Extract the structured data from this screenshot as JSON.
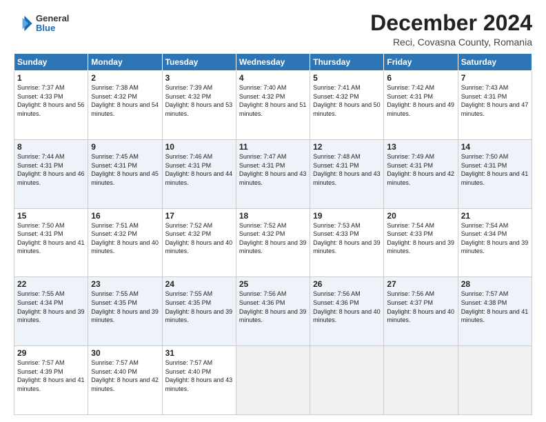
{
  "logo": {
    "general": "General",
    "blue": "Blue"
  },
  "title": "December 2024",
  "subtitle": "Reci, Covasna County, Romania",
  "days_header": [
    "Sunday",
    "Monday",
    "Tuesday",
    "Wednesday",
    "Thursday",
    "Friday",
    "Saturday"
  ],
  "weeks": [
    [
      {
        "day": "1",
        "sunrise": "Sunrise: 7:37 AM",
        "sunset": "Sunset: 4:33 PM",
        "daylight": "Daylight: 8 hours and 56 minutes."
      },
      {
        "day": "2",
        "sunrise": "Sunrise: 7:38 AM",
        "sunset": "Sunset: 4:32 PM",
        "daylight": "Daylight: 8 hours and 54 minutes."
      },
      {
        "day": "3",
        "sunrise": "Sunrise: 7:39 AM",
        "sunset": "Sunset: 4:32 PM",
        "daylight": "Daylight: 8 hours and 53 minutes."
      },
      {
        "day": "4",
        "sunrise": "Sunrise: 7:40 AM",
        "sunset": "Sunset: 4:32 PM",
        "daylight": "Daylight: 8 hours and 51 minutes."
      },
      {
        "day": "5",
        "sunrise": "Sunrise: 7:41 AM",
        "sunset": "Sunset: 4:32 PM",
        "daylight": "Daylight: 8 hours and 50 minutes."
      },
      {
        "day": "6",
        "sunrise": "Sunrise: 7:42 AM",
        "sunset": "Sunset: 4:31 PM",
        "daylight": "Daylight: 8 hours and 49 minutes."
      },
      {
        "day": "7",
        "sunrise": "Sunrise: 7:43 AM",
        "sunset": "Sunset: 4:31 PM",
        "daylight": "Daylight: 8 hours and 47 minutes."
      }
    ],
    [
      {
        "day": "8",
        "sunrise": "Sunrise: 7:44 AM",
        "sunset": "Sunset: 4:31 PM",
        "daylight": "Daylight: 8 hours and 46 minutes."
      },
      {
        "day": "9",
        "sunrise": "Sunrise: 7:45 AM",
        "sunset": "Sunset: 4:31 PM",
        "daylight": "Daylight: 8 hours and 45 minutes."
      },
      {
        "day": "10",
        "sunrise": "Sunrise: 7:46 AM",
        "sunset": "Sunset: 4:31 PM",
        "daylight": "Daylight: 8 hours and 44 minutes."
      },
      {
        "day": "11",
        "sunrise": "Sunrise: 7:47 AM",
        "sunset": "Sunset: 4:31 PM",
        "daylight": "Daylight: 8 hours and 43 minutes."
      },
      {
        "day": "12",
        "sunrise": "Sunrise: 7:48 AM",
        "sunset": "Sunset: 4:31 PM",
        "daylight": "Daylight: 8 hours and 43 minutes."
      },
      {
        "day": "13",
        "sunrise": "Sunrise: 7:49 AM",
        "sunset": "Sunset: 4:31 PM",
        "daylight": "Daylight: 8 hours and 42 minutes."
      },
      {
        "day": "14",
        "sunrise": "Sunrise: 7:50 AM",
        "sunset": "Sunset: 4:31 PM",
        "daylight": "Daylight: 8 hours and 41 minutes."
      }
    ],
    [
      {
        "day": "15",
        "sunrise": "Sunrise: 7:50 AM",
        "sunset": "Sunset: 4:31 PM",
        "daylight": "Daylight: 8 hours and 41 minutes."
      },
      {
        "day": "16",
        "sunrise": "Sunrise: 7:51 AM",
        "sunset": "Sunset: 4:32 PM",
        "daylight": "Daylight: 8 hours and 40 minutes."
      },
      {
        "day": "17",
        "sunrise": "Sunrise: 7:52 AM",
        "sunset": "Sunset: 4:32 PM",
        "daylight": "Daylight: 8 hours and 40 minutes."
      },
      {
        "day": "18",
        "sunrise": "Sunrise: 7:52 AM",
        "sunset": "Sunset: 4:32 PM",
        "daylight": "Daylight: 8 hours and 39 minutes."
      },
      {
        "day": "19",
        "sunrise": "Sunrise: 7:53 AM",
        "sunset": "Sunset: 4:33 PM",
        "daylight": "Daylight: 8 hours and 39 minutes."
      },
      {
        "day": "20",
        "sunrise": "Sunrise: 7:54 AM",
        "sunset": "Sunset: 4:33 PM",
        "daylight": "Daylight: 8 hours and 39 minutes."
      },
      {
        "day": "21",
        "sunrise": "Sunrise: 7:54 AM",
        "sunset": "Sunset: 4:34 PM",
        "daylight": "Daylight: 8 hours and 39 minutes."
      }
    ],
    [
      {
        "day": "22",
        "sunrise": "Sunrise: 7:55 AM",
        "sunset": "Sunset: 4:34 PM",
        "daylight": "Daylight: 8 hours and 39 minutes."
      },
      {
        "day": "23",
        "sunrise": "Sunrise: 7:55 AM",
        "sunset": "Sunset: 4:35 PM",
        "daylight": "Daylight: 8 hours and 39 minutes."
      },
      {
        "day": "24",
        "sunrise": "Sunrise: 7:55 AM",
        "sunset": "Sunset: 4:35 PM",
        "daylight": "Daylight: 8 hours and 39 minutes."
      },
      {
        "day": "25",
        "sunrise": "Sunrise: 7:56 AM",
        "sunset": "Sunset: 4:36 PM",
        "daylight": "Daylight: 8 hours and 39 minutes."
      },
      {
        "day": "26",
        "sunrise": "Sunrise: 7:56 AM",
        "sunset": "Sunset: 4:36 PM",
        "daylight": "Daylight: 8 hours and 40 minutes."
      },
      {
        "day": "27",
        "sunrise": "Sunrise: 7:56 AM",
        "sunset": "Sunset: 4:37 PM",
        "daylight": "Daylight: 8 hours and 40 minutes."
      },
      {
        "day": "28",
        "sunrise": "Sunrise: 7:57 AM",
        "sunset": "Sunset: 4:38 PM",
        "daylight": "Daylight: 8 hours and 41 minutes."
      }
    ],
    [
      {
        "day": "29",
        "sunrise": "Sunrise: 7:57 AM",
        "sunset": "Sunset: 4:39 PM",
        "daylight": "Daylight: 8 hours and 41 minutes."
      },
      {
        "day": "30",
        "sunrise": "Sunrise: 7:57 AM",
        "sunset": "Sunset: 4:40 PM",
        "daylight": "Daylight: 8 hours and 42 minutes."
      },
      {
        "day": "31",
        "sunrise": "Sunrise: 7:57 AM",
        "sunset": "Sunset: 4:40 PM",
        "daylight": "Daylight: 8 hours and 43 minutes."
      },
      null,
      null,
      null,
      null
    ]
  ]
}
